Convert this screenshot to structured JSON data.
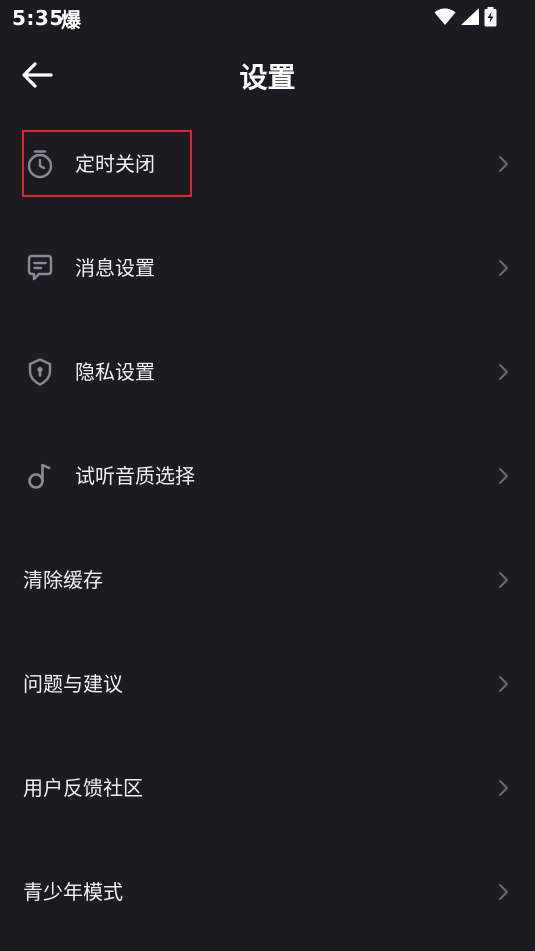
{
  "status_bar": {
    "time": "5:35",
    "app_notification_glyph": "爆",
    "icons": [
      "wifi-icon",
      "signal-icon",
      "battery-charging-icon"
    ]
  },
  "header": {
    "title": "设置",
    "back_icon": "arrow-left-icon"
  },
  "settings": {
    "items": [
      {
        "label": "定时关闭",
        "icon": "timer-icon",
        "highlighted": true
      },
      {
        "label": "消息设置",
        "icon": "message-icon"
      },
      {
        "label": "隐私设置",
        "icon": "shield-lock-icon"
      },
      {
        "label": "试听音质选择",
        "icon": "music-note-icon"
      },
      {
        "label": "清除缓存"
      },
      {
        "label": "问题与建议"
      },
      {
        "label": "用户反馈社区"
      },
      {
        "label": "青少年模式"
      }
    ]
  },
  "colors": {
    "background": "#1b1b21",
    "text": "#f2f2f4",
    "icon": "#8a8a96",
    "chevron": "#6b6b75",
    "highlight": "#e0262b"
  }
}
